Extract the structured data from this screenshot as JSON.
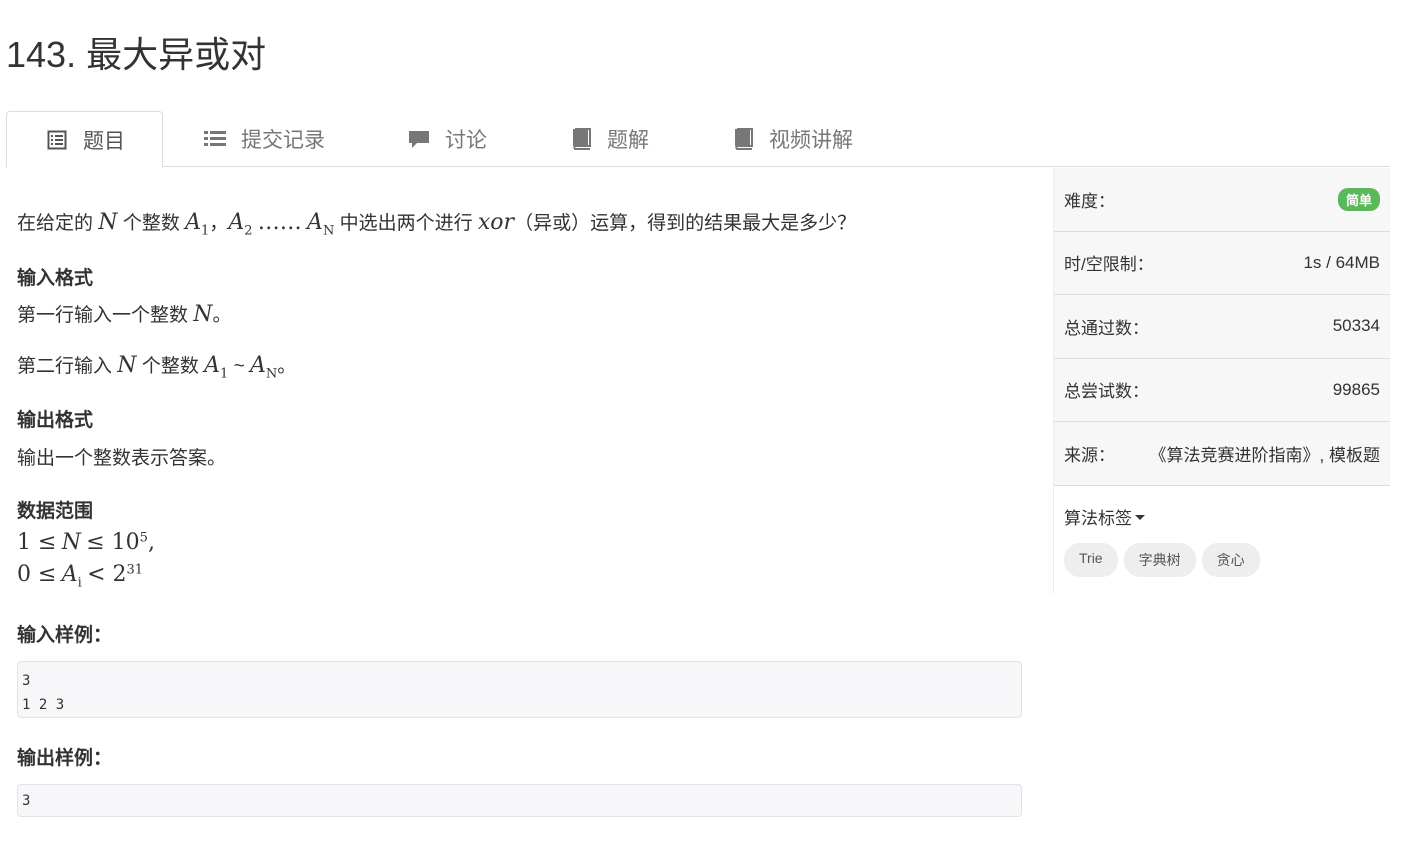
{
  "problem": {
    "title": "143. 最大异或对"
  },
  "tabs": [
    {
      "label": "题目",
      "icon": "list-alt-icon"
    },
    {
      "label": "提交记录",
      "icon": "list-icon"
    },
    {
      "label": "讨论",
      "icon": "comment-icon"
    },
    {
      "label": "题解",
      "icon": "book-icon"
    },
    {
      "label": "视频讲解",
      "icon": "book-icon"
    }
  ],
  "statement": {
    "intro_1": "在给定的",
    "intro_2": "个整数",
    "intro_3": "中选出两个进行",
    "intro_4": "（异或）运算，得到的结果最大是多少？",
    "var_N": "N",
    "var_A": "A",
    "sub_1": "1",
    "sub_2": "2",
    "sub_N": "N",
    "sub_i": "i",
    "comma": "，",
    "dots": "……",
    "op": "xor"
  },
  "input_format": {
    "heading": "输入格式",
    "line1_a": "第一行输入一个整数",
    "line1_b": "。",
    "line2_a": "第二行输入",
    "line2_b": "个整数",
    "line2_c": "~",
    "line2_d": "。"
  },
  "output_format": {
    "heading": "输出格式",
    "line": "输出一个整数表示答案。"
  },
  "range": {
    "heading": "数据范围",
    "r1_a": "1 ≤",
    "r1_b": "≤ 10",
    "r1_exp": "5",
    "r1_c": ",",
    "r2_a": "0 ≤",
    "r2_b": "< 2",
    "r2_exp": "31"
  },
  "sample_input": {
    "heading": "输入样例：",
    "text": "3\n1 2 3"
  },
  "sample_output": {
    "heading": "输出样例：",
    "text": "3"
  },
  "sidebar": {
    "difficulty_label": "难度：",
    "difficulty_value": "简单",
    "limit_label": "时/空限制：",
    "limit_value": "1s / 64MB",
    "passed_label": "总通过数：",
    "passed_value": "50334",
    "tries_label": "总尝试数：",
    "tries_value": "99865",
    "source_label": "来源：",
    "source_value": "《算法竞赛进阶指南》, 模板题",
    "tags_label": "算法标签",
    "tags": [
      "Trie",
      "字典树",
      "贪心"
    ]
  },
  "colors": {
    "easy_badge": "#5cb85c",
    "tag_bg": "#eeeeee",
    "tab_text": "#777777"
  }
}
